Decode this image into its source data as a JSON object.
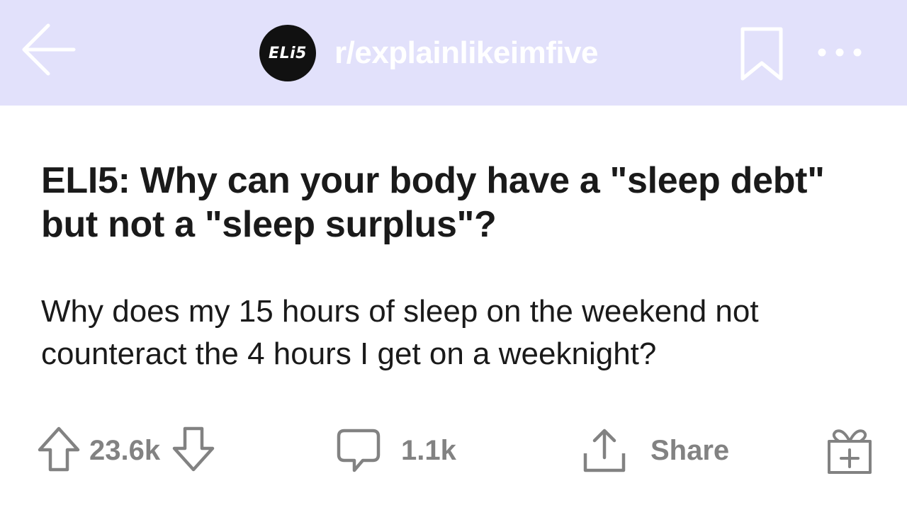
{
  "header": {
    "subreddit_avatar_text": "ELi5",
    "subreddit_name": "r/explainlikeimfive",
    "back_icon": "arrow-left-icon",
    "bookmark_icon": "bookmark-icon",
    "more_icon": "more-horizontal-icon"
  },
  "post": {
    "title": "ELI5: Why can your body have a \"sleep debt\" but not a \"sleep surplus\"?",
    "body": "Why does my 15 hours of sleep on the weekend not counteract the 4 hours I get on a weeknight?"
  },
  "actions": {
    "upvote_icon": "upvote-arrow-icon",
    "vote_count": "23.6k",
    "downvote_icon": "downvote-arrow-icon",
    "comment_icon": "comment-bubble-icon",
    "comment_count": "1.1k",
    "share_icon": "share-icon",
    "share_label": "Share",
    "award_icon": "gift-award-icon"
  },
  "colors": {
    "header_bg": "#e2e1fb",
    "action_gray": "#828282",
    "text": "#1a1a1a"
  }
}
